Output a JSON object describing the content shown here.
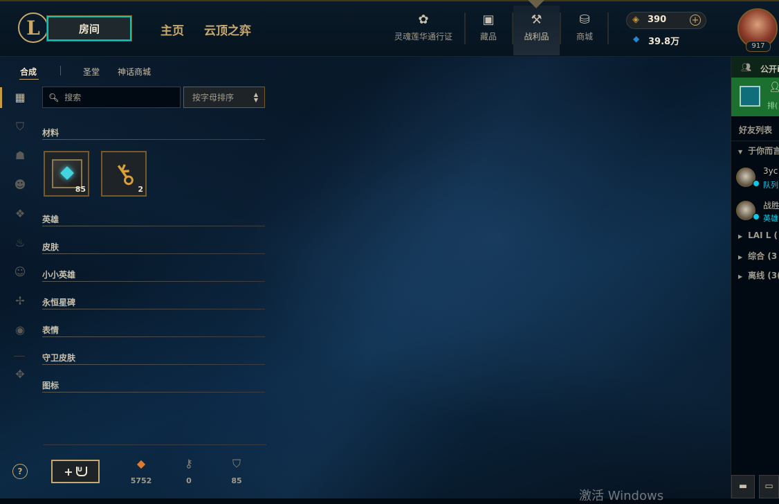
{
  "topnav": {
    "play_label": "房间",
    "home_label": "主页",
    "tft_label": "云顶之弈",
    "items": [
      {
        "label": "灵魂莲华通行证",
        "icon": "lotus-icon"
      },
      {
        "label": "藏品",
        "icon": "bag-icon"
      },
      {
        "label": "战利品",
        "icon": "loot-icon"
      },
      {
        "label": "商城",
        "icon": "coins-icon"
      }
    ],
    "rp": "390",
    "blue_essence": "39.8万",
    "level": "917"
  },
  "subtabs": [
    "合成",
    "圣堂",
    "神话商城"
  ],
  "search": {
    "placeholder": "搜索"
  },
  "sort": {
    "label": "按字母排序"
  },
  "categories": [
    "材料",
    "英雄",
    "皮肤",
    "小小英雄",
    "永恒星碑",
    "表情",
    "守卫皮肤",
    "图标"
  ],
  "materials": [
    {
      "name": "hextech-chest",
      "count": "85"
    },
    {
      "name": "key",
      "count": "2"
    }
  ],
  "resources": [
    {
      "name": "orange-essence",
      "value": "5752"
    },
    {
      "name": "key-fragment",
      "value": "0"
    },
    {
      "name": "chest-shard",
      "value": "85"
    }
  ],
  "craft": {
    "plus": "+",
    "icon_text": "U"
  },
  "social": {
    "public_label": "公开i",
    "profile_status": "排(",
    "title": "好友列表",
    "group_open": "于你而言",
    "friends": [
      {
        "name": "3yc",
        "status": "队列"
      },
      {
        "name": "战胜",
        "status": "英雄"
      }
    ],
    "groups": [
      "LAI L (",
      "综合 (3",
      "离线 (3("
    ]
  },
  "help_label": "?",
  "watermark": "激活 Windows"
}
